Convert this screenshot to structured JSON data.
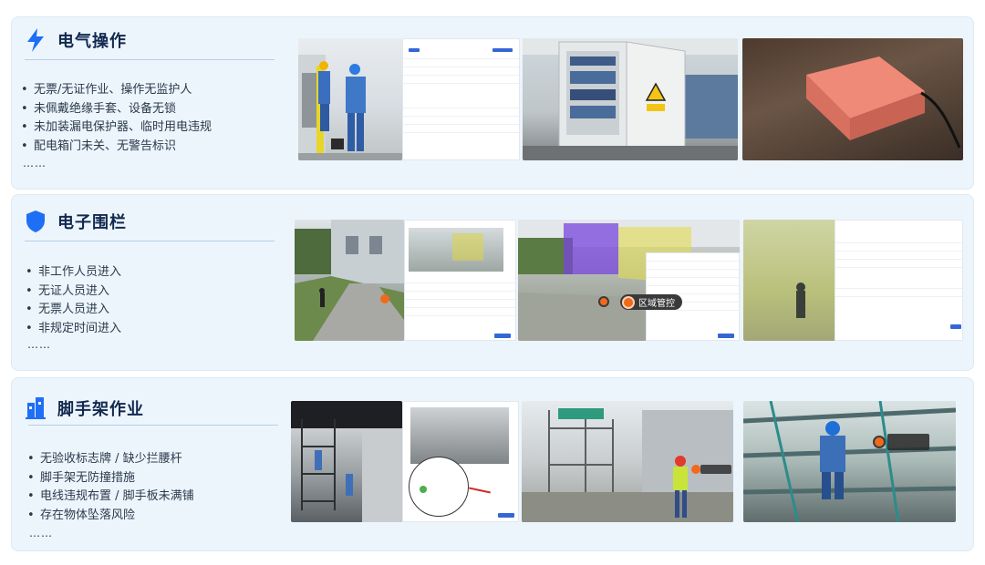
{
  "sections": [
    {
      "title": "电气操作",
      "icon": "lightning-icon",
      "items": [
        "无票/无证作业、操作无监护人",
        "未佩戴绝缘手套、设备无锁",
        "未加装漏电保护器、临时用电违规",
        "配电箱门未关、无警告标识"
      ],
      "more": "……"
    },
    {
      "title": "电子围栏",
      "icon": "shield-icon",
      "items": [
        "非工作人员进入",
        "无证人员进入",
        "无票人员进入",
        "非规定时间进入"
      ],
      "more": "……",
      "image_tag": "区域管控"
    },
    {
      "title": "脚手架作业",
      "icon": "building-icon",
      "items": [
        "无验收标志牌 / 缺少拦腰杆",
        "脚手架无防撞措施",
        "电线违规布置 / 脚手板未满铺",
        "存在物体坠落风险"
      ],
      "more": "……"
    }
  ],
  "colors": {
    "accent": "#1e6ff5",
    "card_bg": "#edf5fc",
    "title": "#12294f",
    "tag_orange": "#f06a1b"
  }
}
